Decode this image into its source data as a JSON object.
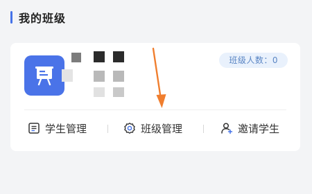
{
  "section": {
    "title": "我的班级"
  },
  "class_card": {
    "student_count_label": "班级人数：0",
    "avatar_icon": "presentation-board-icon",
    "actions": [
      {
        "label": "学生管理",
        "icon": "student-list-icon"
      },
      {
        "label": "班级管理",
        "icon": "settings-gear-icon"
      },
      {
        "label": "邀请学生",
        "icon": "invite-user-icon"
      }
    ]
  },
  "colors": {
    "accent": "#4472e8",
    "avatar_bg": "#4a73e8",
    "badge_bg": "#e9f1fc",
    "badge_text": "#5b86c4",
    "annotation_arrow": "#f07e2e"
  }
}
